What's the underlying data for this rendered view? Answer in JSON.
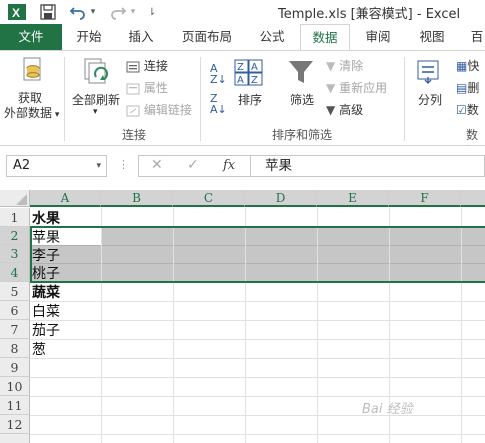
{
  "title": {
    "text": "Temple.xls  [兼容模式] - Excel"
  },
  "tabs": [
    "文件",
    "开始",
    "插入",
    "页面布局",
    "公式",
    "数据",
    "审阅",
    "视图",
    "百"
  ],
  "ribbon": {
    "get_external_1": "获取",
    "get_external_2": "外部数据",
    "refresh_all": "全部刷新",
    "connections": "连接",
    "properties": "属性",
    "edit_links": "编辑链接",
    "group_connections": "连接",
    "sort_icon_az": "A Z",
    "sort": "排序",
    "filter": "筛选",
    "clear": "清除",
    "reapply": "重新应用",
    "advanced": "高级",
    "group_sort_filter": "排序和筛选",
    "split": "分列",
    "quick": "快",
    "delete": "删",
    "data": "数",
    "group_data": "数据"
  },
  "formula_bar": {
    "name_box": "A2",
    "fx": "fx",
    "content": "苹果"
  },
  "grid": {
    "columns": [
      "A",
      "B",
      "C",
      "D",
      "E",
      "F"
    ],
    "rows": [
      "1",
      "2",
      "3",
      "4",
      "5",
      "6",
      "7",
      "8",
      "9",
      "10",
      "11",
      "12"
    ],
    "cells": {
      "a1": "水果",
      "a2": "苹果",
      "a3": "李子",
      "a4": "桃子",
      "a5": "蔬菜",
      "a6": "白菜",
      "a7": "茄子",
      "a8": "葱"
    }
  },
  "watermark": "Bai 经验"
}
